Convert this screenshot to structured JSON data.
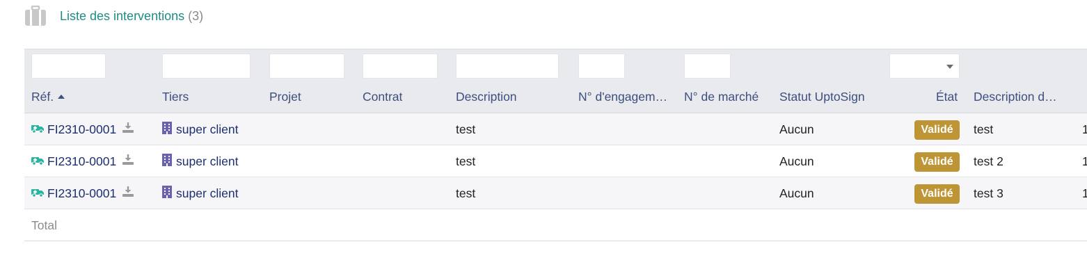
{
  "title": {
    "text": "Liste des interventions",
    "count": "(3)"
  },
  "columns": {
    "ref": "Réf.",
    "tiers": "Tiers",
    "projet": "Projet",
    "contrat": "Contrat",
    "description": "Description",
    "engagement": "N° d'engagem…",
    "marche": "N° de marché",
    "statut_uptosign": "Statut UptoSign",
    "etat": "État",
    "description_detail": "Description d…"
  },
  "rows": [
    {
      "ref": "FI2310-0001",
      "tiers": "super client",
      "projet": "",
      "contrat": "",
      "description": "test",
      "engagement": "",
      "marche": "",
      "statut_uptosign": "Aucun",
      "etat": "Validé",
      "description_detail": "test",
      "last": "1"
    },
    {
      "ref": "FI2310-0001",
      "tiers": "super client",
      "projet": "",
      "contrat": "",
      "description": "test",
      "engagement": "",
      "marche": "",
      "statut_uptosign": "Aucun",
      "etat": "Validé",
      "description_detail": "test 2",
      "last": "1"
    },
    {
      "ref": "FI2310-0001",
      "tiers": "super client",
      "projet": "",
      "contrat": "",
      "description": "test",
      "engagement": "",
      "marche": "",
      "statut_uptosign": "Aucun",
      "etat": "Validé",
      "description_detail": "test 3",
      "last": "1"
    }
  ],
  "total_label": "Total",
  "icons": {
    "title": "briefcase-icon",
    "ref": "intervention-truck-icon",
    "download": "download-icon",
    "tiers": "building-icon",
    "sort": "sort-ascending-icon",
    "select": "chevron-down-icon"
  },
  "colors": {
    "title": "#1e8c84",
    "header_text": "#3d4e80",
    "link": "#1c2f6e",
    "badge_validated": "#bd9535",
    "truck_icon": "#2bb5a0",
    "building_icon": "#6a62b0"
  }
}
